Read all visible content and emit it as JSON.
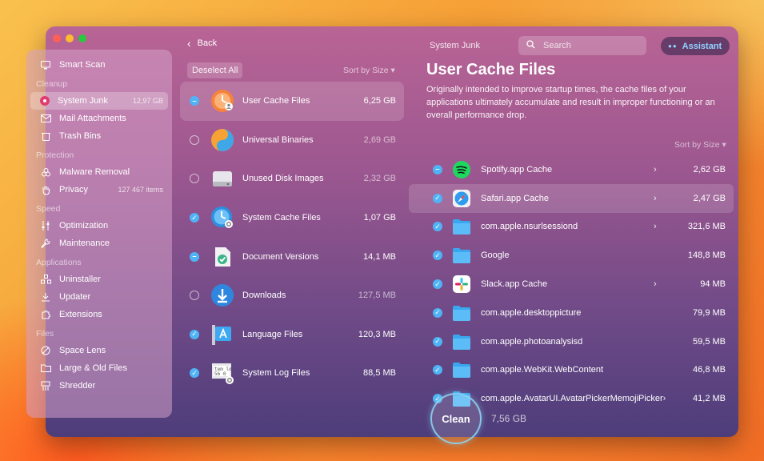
{
  "sidebar": {
    "top": {
      "label": "Smart Scan",
      "icon": "monitor-icon"
    },
    "sections": [
      {
        "title": "Cleanup",
        "items": [
          {
            "label": "System Junk",
            "meta": "12,97 GB",
            "icon": "system-junk-icon",
            "active": true
          },
          {
            "label": "Mail Attachments",
            "meta": "",
            "icon": "mail-icon"
          },
          {
            "label": "Trash Bins",
            "meta": "",
            "icon": "trash-icon"
          }
        ]
      },
      {
        "title": "Protection",
        "items": [
          {
            "label": "Malware Removal",
            "meta": "",
            "icon": "biohazard-icon"
          },
          {
            "label": "Privacy",
            "meta": "127 467 items",
            "icon": "hand-icon"
          }
        ]
      },
      {
        "title": "Speed",
        "items": [
          {
            "label": "Optimization",
            "meta": "",
            "icon": "sliders-icon"
          },
          {
            "label": "Maintenance",
            "meta": "",
            "icon": "wrench-icon"
          }
        ]
      },
      {
        "title": "Applications",
        "items": [
          {
            "label": "Uninstaller",
            "meta": "",
            "icon": "uninstaller-icon"
          },
          {
            "label": "Updater",
            "meta": "",
            "icon": "updater-icon"
          },
          {
            "label": "Extensions",
            "meta": "",
            "icon": "extensions-icon"
          }
        ]
      },
      {
        "title": "Files",
        "items": [
          {
            "label": "Space Lens",
            "meta": "",
            "icon": "space-lens-icon"
          },
          {
            "label": "Large & Old Files",
            "meta": "",
            "icon": "folder-icon"
          },
          {
            "label": "Shredder",
            "meta": "",
            "icon": "shredder-icon"
          }
        ]
      }
    ]
  },
  "middle": {
    "back_label": "Back",
    "deselect_label": "Deselect All",
    "sort_label": "Sort by Size ▾",
    "items": [
      {
        "name": "User Cache Files",
        "size": "6,25 GB",
        "state": "partial",
        "icon": "user-cache-icon",
        "active": true,
        "dim": false
      },
      {
        "name": "Universal Binaries",
        "size": "2,69 GB",
        "state": "unchecked",
        "icon": "universal-binaries-icon",
        "dim": true
      },
      {
        "name": "Unused Disk Images",
        "size": "2,32 GB",
        "state": "unchecked",
        "icon": "disk-image-icon",
        "dim": true
      },
      {
        "name": "System Cache Files",
        "size": "1,07 GB",
        "state": "checked",
        "icon": "system-cache-icon",
        "dim": false
      },
      {
        "name": "Document Versions",
        "size": "14,1 MB",
        "state": "partial",
        "icon": "document-versions-icon",
        "dim": false
      },
      {
        "name": "Downloads",
        "size": "127,5 MB",
        "state": "unchecked",
        "icon": "downloads-icon",
        "dim": true
      },
      {
        "name": "Language Files",
        "size": "120,3 MB",
        "state": "checked",
        "icon": "language-files-icon",
        "dim": false
      },
      {
        "name": "System Log Files",
        "size": "88,5 MB",
        "state": "checked",
        "icon": "log-files-icon",
        "dim": false
      }
    ]
  },
  "header": {
    "section_title": "System Junk",
    "search_placeholder": "Search",
    "assistant_label": "Assistant"
  },
  "detail": {
    "title": "User Cache Files",
    "description": "Originally intended to improve startup times, the cache files of your applications ultimately accumulate and result in improper functioning or an overall performance drop.",
    "sort_label": "Sort by Size ▾",
    "items": [
      {
        "name": "Spotify.app Cache",
        "size": "2,62 GB",
        "state": "partial",
        "icon": "spotify-icon",
        "chevron": true
      },
      {
        "name": "Safari.app Cache",
        "size": "2,47 GB",
        "state": "checked",
        "icon": "safari-icon",
        "chevron": true,
        "active": true
      },
      {
        "name": "com.apple.nsurlsessiond",
        "size": "321,6 MB",
        "state": "checked",
        "icon": "folder-icon",
        "chevron": true
      },
      {
        "name": "Google",
        "size": "148,8 MB",
        "state": "checked",
        "icon": "folder-icon",
        "chevron": false
      },
      {
        "name": "Slack.app Cache",
        "size": "94 MB",
        "state": "checked",
        "icon": "slack-icon",
        "chevron": true
      },
      {
        "name": "com.apple.desktoppicture",
        "size": "79,9 MB",
        "state": "checked",
        "icon": "folder-icon",
        "chevron": false
      },
      {
        "name": "com.apple.photoanalysisd",
        "size": "59,5 MB",
        "state": "checked",
        "icon": "folder-icon",
        "chevron": false
      },
      {
        "name": "com.apple.WebKit.WebContent",
        "size": "46,8 MB",
        "state": "checked",
        "icon": "folder-icon",
        "chevron": false
      },
      {
        "name": "com.apple.AvatarUI.AvatarPickerMemojiPicker",
        "size": "41,2 MB",
        "state": "checked",
        "icon": "folder-icon",
        "chevron": true
      }
    ]
  },
  "footer": {
    "clean_label": "Clean",
    "total": "7,56 GB"
  },
  "colors": {
    "accent": "#4fb3f6",
    "folder": "#3aa6f0"
  }
}
